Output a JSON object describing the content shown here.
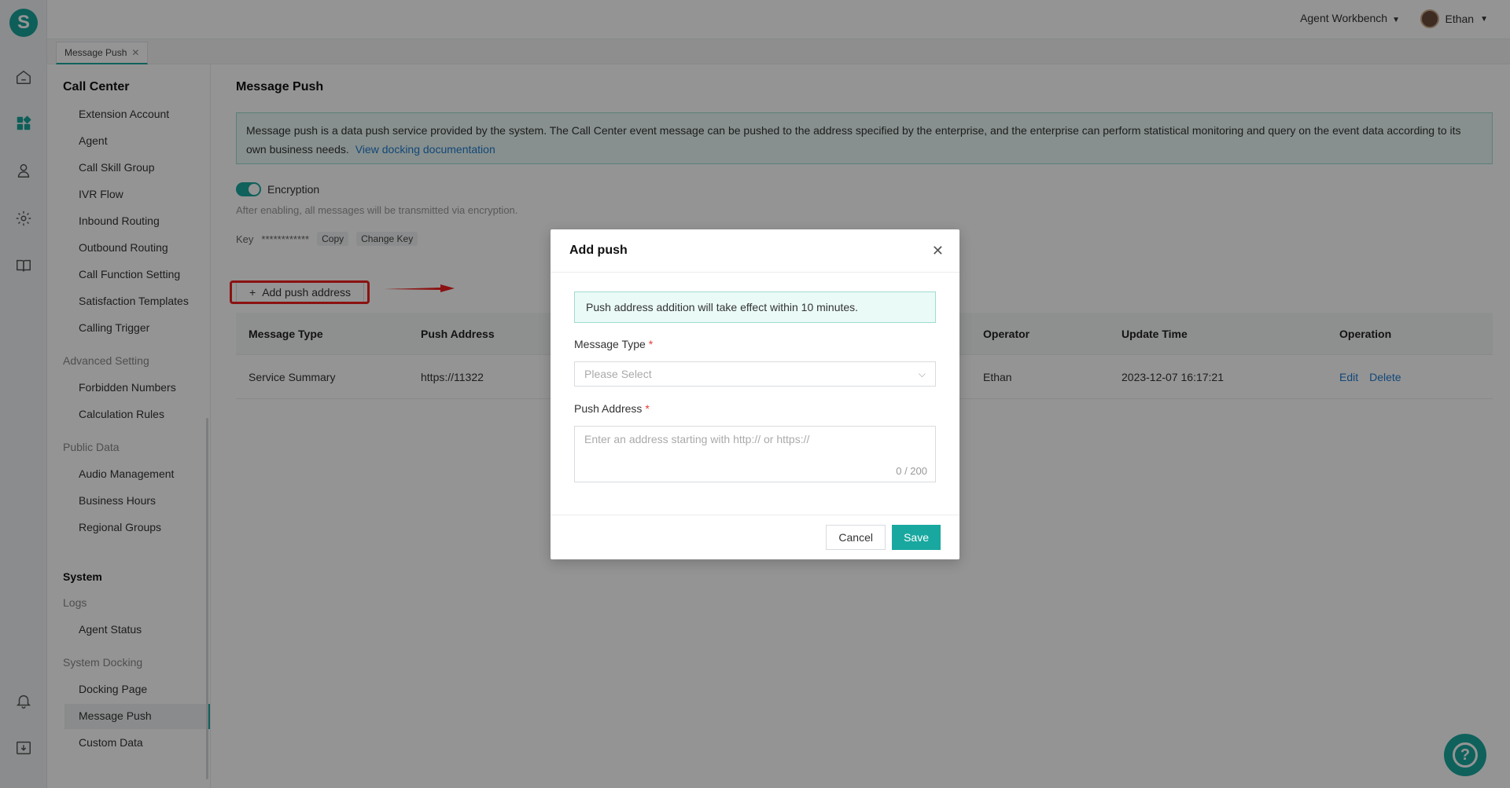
{
  "app": {
    "logo_letter": "S",
    "accent_color": "#1aa89f"
  },
  "topbar": {
    "workbench_label": "Agent Workbench",
    "user_name": "Ethan"
  },
  "tabs": [
    {
      "label": "Message Push"
    }
  ],
  "sidebar": {
    "call_center": {
      "title": "Call Center",
      "items": [
        "Extension Account",
        "Agent",
        "Call Skill Group",
        "IVR Flow",
        "Inbound Routing",
        "Outbound Routing",
        "Call Function Setting",
        "Satisfaction Templates",
        "Calling Trigger"
      ]
    },
    "advanced": {
      "title": "Advanced Setting",
      "items": [
        "Forbidden Numbers",
        "Calculation Rules"
      ]
    },
    "public_data": {
      "title": "Public Data",
      "items": [
        "Audio Management",
        "Business Hours",
        "Regional Groups"
      ]
    },
    "system": {
      "title": "System",
      "logs_title": "Logs",
      "logs_items": [
        "Agent Status"
      ],
      "docking_title": "System Docking",
      "docking_items": [
        "Docking Page",
        "Message Push",
        "Custom Data"
      ]
    }
  },
  "main": {
    "title": "Message Push",
    "info_text": "Message push is a data push service provided by the system. The Call Center event message can be pushed to the address specified by the enterprise, and the enterprise can perform statistical monitoring and query on the event data according to its own business needs.",
    "info_link": "View docking documentation",
    "encryption_label": "Encryption",
    "encryption_enabled": true,
    "encryption_note": "After enabling, all messages will be transmitted via encryption.",
    "key_label": "Key",
    "key_value": "************",
    "copy_label": "Copy",
    "change_key_label": "Change Key",
    "add_button": "Add push address",
    "table": {
      "headers": [
        "Message Type",
        "Push Address",
        "Operator",
        "Update Time",
        "Operation"
      ],
      "rows": [
        {
          "message_type": "Service Summary",
          "push_address": "https://11322",
          "operator": "Ethan",
          "update_time": "2023-12-07 16:17:21",
          "edit": "Edit",
          "delete": "Delete"
        }
      ]
    }
  },
  "modal": {
    "title": "Add push",
    "notice": "Push address addition will take effect within 10 minutes.",
    "message_type_label": "Message Type",
    "message_type_placeholder": "Please Select",
    "push_address_label": "Push Address",
    "push_address_placeholder": "Enter an address starting with http:// or https://",
    "char_count": "0 / 200",
    "cancel": "Cancel",
    "save": "Save",
    "required_mark": "*"
  },
  "help": {
    "glyph": "?"
  }
}
